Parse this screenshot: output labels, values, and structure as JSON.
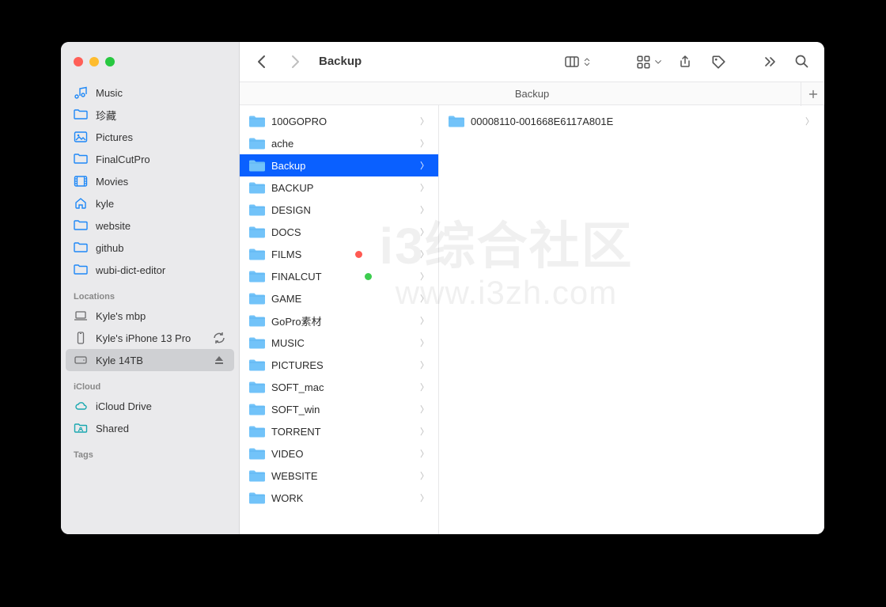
{
  "window": {
    "title": "Backup"
  },
  "pathbar": {
    "label": "Backup"
  },
  "sidebar": {
    "items": [
      {
        "name": "Music",
        "icon": "music"
      },
      {
        "name": "珍藏",
        "icon": "folder"
      },
      {
        "name": "Pictures",
        "icon": "picture"
      },
      {
        "name": "FinalCutPro",
        "icon": "folder"
      },
      {
        "name": "Movies",
        "icon": "movie"
      },
      {
        "name": "kyle",
        "icon": "home"
      },
      {
        "name": "website",
        "icon": "folder"
      },
      {
        "name": "github",
        "icon": "folder"
      },
      {
        "name": "wubi-dict-editor",
        "icon": "folder"
      }
    ],
    "locations_label": "Locations",
    "locations": [
      {
        "name": "Kyle's mbp",
        "icon": "laptop",
        "sync": false
      },
      {
        "name": "Kyle's iPhone 13 Pro",
        "icon": "phone",
        "sync": true
      },
      {
        "name": "Kyle 14TB",
        "icon": "disk",
        "eject": true,
        "active": true
      }
    ],
    "icloud_label": "iCloud",
    "icloud": [
      {
        "name": "iCloud Drive",
        "icon": "cloud"
      },
      {
        "name": "Shared",
        "icon": "shared-folder"
      }
    ],
    "tags_label": "Tags"
  },
  "columns": {
    "c1": [
      {
        "name": "100GOPRO"
      },
      {
        "name": "ache"
      },
      {
        "name": "Backup",
        "selected": true
      },
      {
        "name": "BACKUP"
      },
      {
        "name": "DESIGN"
      },
      {
        "name": "DOCS"
      },
      {
        "name": "FILMS",
        "tag": "red"
      },
      {
        "name": "FINALCUT",
        "tag": "green"
      },
      {
        "name": "GAME"
      },
      {
        "name": "GoPro素材"
      },
      {
        "name": "MUSIC"
      },
      {
        "name": "PICTURES"
      },
      {
        "name": "SOFT_mac"
      },
      {
        "name": "SOFT_win"
      },
      {
        "name": "TORRENT"
      },
      {
        "name": "VIDEO"
      },
      {
        "name": "WEBSITE"
      },
      {
        "name": "WORK"
      }
    ],
    "c2": [
      {
        "name": "00008110-001668E6117A801E"
      }
    ]
  },
  "watermark": {
    "line1": "i3综合社区",
    "line2": "www.i3zh.com"
  }
}
